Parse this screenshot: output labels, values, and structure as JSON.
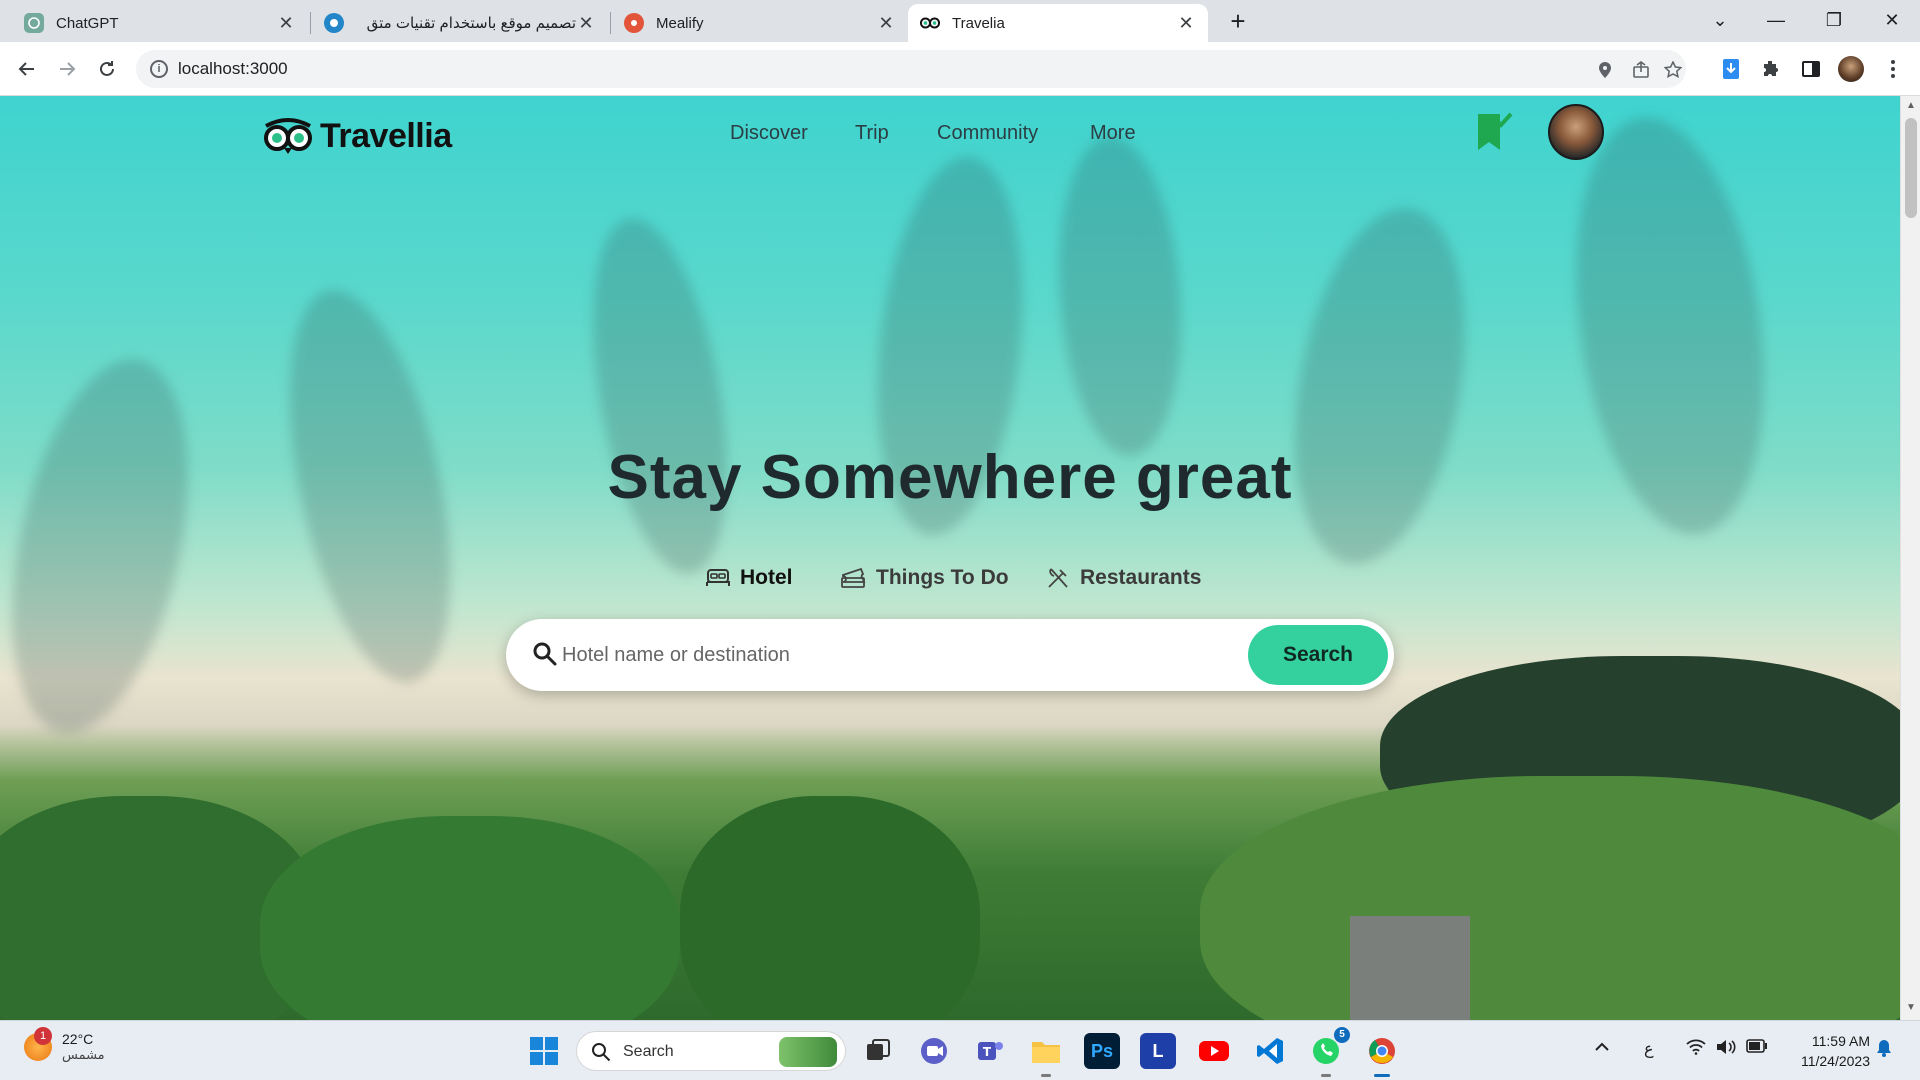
{
  "browser": {
    "tabs": [
      {
        "title": "ChatGPT",
        "favicon": "chatgpt-icon",
        "active": false
      },
      {
        "title": "تصميم موقع باستخدام تقنيات متق",
        "favicon": "mostaql-icon",
        "active": false
      },
      {
        "title": "Mealify",
        "favicon": "mealify-icon",
        "active": false
      },
      {
        "title": "Travelia",
        "favicon": "travelia-icon",
        "active": true
      }
    ],
    "new_tab": "+",
    "url": "localhost:3000",
    "colors": {
      "chrome": "#dee1e6",
      "toolbar": "#ffffff"
    }
  },
  "site": {
    "brand": "Travellia",
    "nav": [
      "Discover",
      "Trip",
      "Community",
      "More"
    ],
    "hero_title": "Stay Somewhere great",
    "categories": [
      {
        "label": "Hotel",
        "icon": "bed-icon",
        "active": true
      },
      {
        "label": "Things To Do",
        "icon": "ticket-icon",
        "active": false
      },
      {
        "label": "Restaurants",
        "icon": "utensils-icon",
        "active": false
      }
    ],
    "search": {
      "placeholder": "Hotel name or destination",
      "button": "Search"
    },
    "colors": {
      "accent": "#34d19f",
      "bookmark": "#1fa84f",
      "text": "#1f2a2e"
    }
  },
  "taskbar": {
    "weather_temp": "22°C",
    "weather_desc": "مشمس",
    "weather_badge": "1",
    "search_label": "Search",
    "apps": [
      {
        "name": "windows-start-icon"
      },
      {
        "name": "task-view-icon"
      },
      {
        "name": "teams-meet-icon"
      },
      {
        "name": "teams-new-icon"
      },
      {
        "name": "file-explorer-icon"
      },
      {
        "name": "photoshop-icon",
        "label": "Ps"
      },
      {
        "name": "lingoes-icon",
        "label": "L"
      },
      {
        "name": "youtube-icon"
      },
      {
        "name": "vscode-icon"
      },
      {
        "name": "whatsapp-icon",
        "badge": "5"
      },
      {
        "name": "chrome-icon"
      }
    ],
    "tray_lang": "ع",
    "time": "11:59 AM",
    "date": "11/24/2023"
  }
}
